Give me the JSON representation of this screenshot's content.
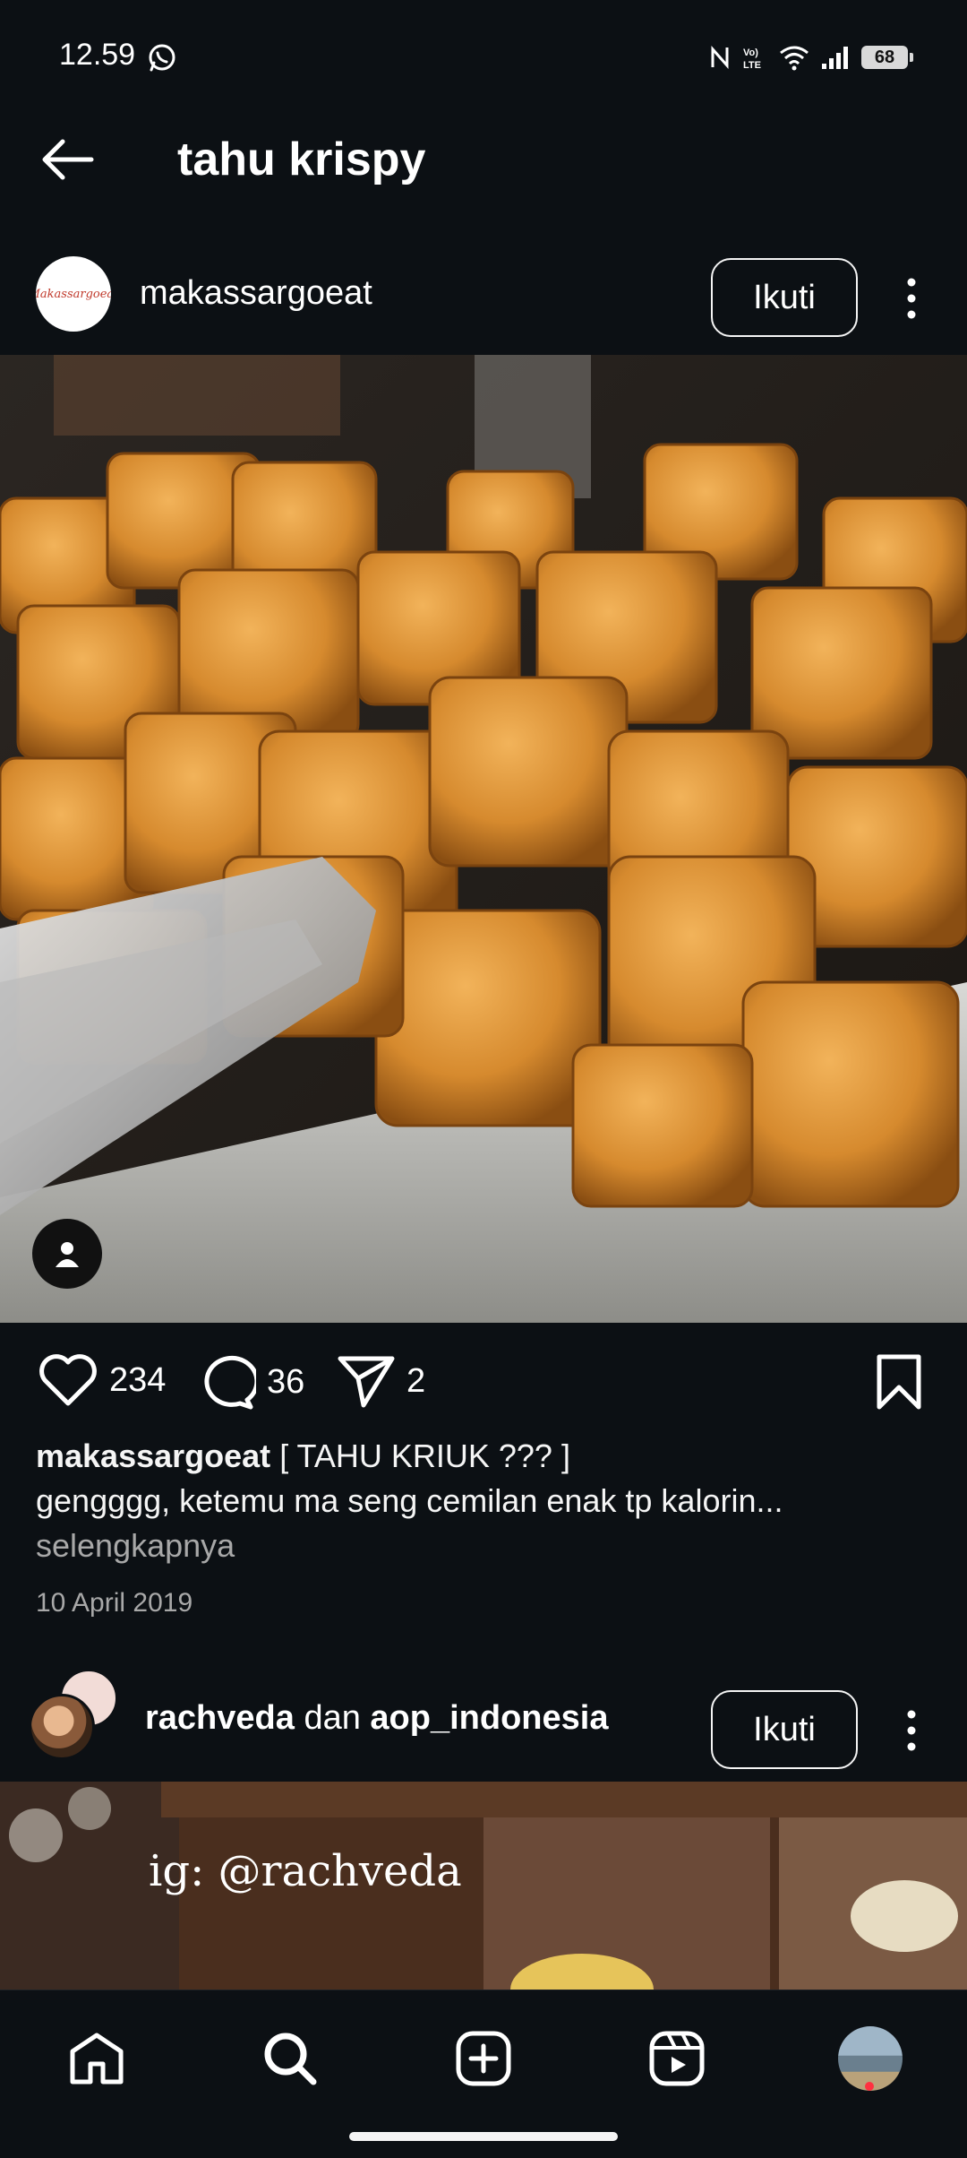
{
  "status_bar": {
    "time": "12.59",
    "battery": "68",
    "icons": [
      "whatsapp-icon",
      "nfc-icon",
      "volte-icon",
      "wifi-icon",
      "signal-icon",
      "battery-icon"
    ]
  },
  "header": {
    "title": "tahu krispy",
    "back_icon": "arrow-left-icon"
  },
  "posts": [
    {
      "username": "makassargoeat",
      "avatar_text": "Makassargoeat",
      "follow_label": "Ikuti",
      "likes": "234",
      "comments": "36",
      "shares": "2",
      "caption_user": "makassargoeat",
      "caption_text": "[ TAHU KRIUK ??? ]",
      "caption_body": "gengggg, ketemu ma seng cemilan enak tp kalorin...",
      "more_label": "selengkapnya",
      "date": "10 April 2019"
    },
    {
      "user1": "rachveda",
      "joiner": "dan",
      "user2": "aop_indonesia",
      "follow_label": "Ikuti",
      "watermark": "ig: @rachveda"
    }
  ],
  "bottom_nav": [
    "home-icon",
    "search-icon",
    "create-icon",
    "reels-icon",
    "profile-avatar"
  ],
  "colors": {
    "background": "#0c1014",
    "text": "#f5f5f5",
    "muted": "#a8a8a8",
    "notification": "#ff3040"
  }
}
